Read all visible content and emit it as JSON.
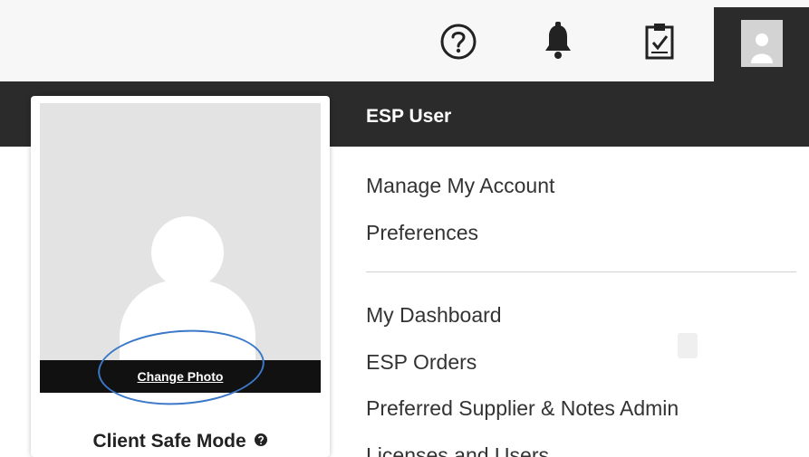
{
  "topbar": {
    "icons": [
      "help-circle-icon",
      "bell-icon",
      "clipboard-check-icon"
    ],
    "avatar_icon": "user-avatar-icon"
  },
  "profile": {
    "change_photo_label": "Change Photo",
    "client_safe_label": "Client Safe Mode",
    "client_safe_help_icon": "help-circle-icon"
  },
  "menu": {
    "header": "ESP User",
    "group1": [
      "Manage My Account",
      "Preferences"
    ],
    "group2": [
      "My Dashboard",
      "ESP Orders",
      "Preferred Supplier & Notes Admin",
      "Licenses and Users"
    ]
  },
  "colors": {
    "dark_band": "#2b2b2b",
    "annotation_circle": "#3b78c8"
  }
}
